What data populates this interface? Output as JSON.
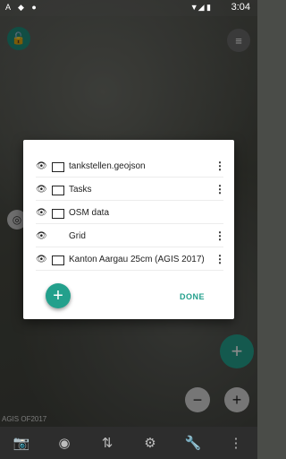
{
  "statusbar": {
    "left_icons": "A ◆ ●",
    "signal": "▼◢ ▮",
    "time": "3:04"
  },
  "map": {
    "watermark": "AGIS OF2017",
    "lock_icon": "🔓",
    "menu_icon": "≡",
    "gps_icon": "◎",
    "add_icon": "+",
    "zoom_out": "−",
    "zoom_in": "+"
  },
  "dialog": {
    "layers": [
      {
        "label": "tankstellen.geojson",
        "has_frame": true
      },
      {
        "label": "Tasks",
        "has_frame": true
      },
      {
        "label": "OSM data",
        "has_frame": true
      },
      {
        "label": "Grid",
        "has_frame": false
      },
      {
        "label": "Kanton Aargau 25cm (AGIS 2017)",
        "has_frame": true
      }
    ],
    "eye_icon": "👁",
    "more_icon": "⋮",
    "add_label": "+",
    "done_label": "DONE"
  },
  "bottombar": {
    "camera": "📷",
    "gps": "◉",
    "transfer": "⇅",
    "settings": "⚙",
    "tools": "🔧",
    "more": "⋮"
  },
  "colors": {
    "accent": "#23a08c"
  }
}
